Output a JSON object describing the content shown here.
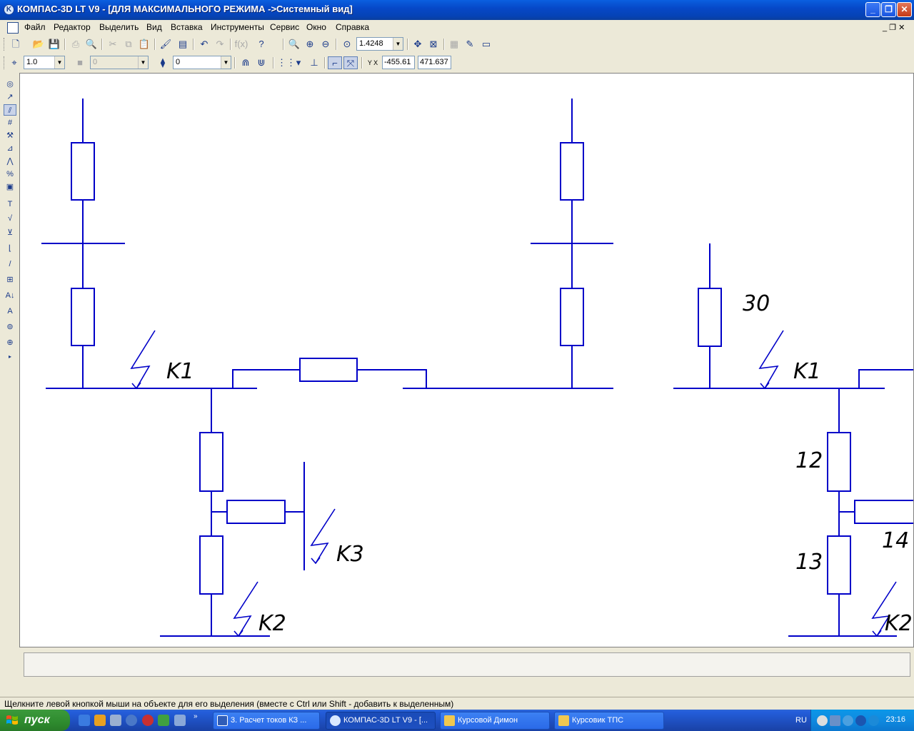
{
  "window": {
    "title": "КОМПАС-3D LT V9 - [ДЛЯ МАКСИМАЛЬНОГО РЕЖИМА ->Системный вид]",
    "minimize": "_",
    "maximize": "❐",
    "close": "✕"
  },
  "menu": {
    "items": [
      "Файл",
      "Редактор",
      "Выделить",
      "Вид",
      "Вставка",
      "Инструменты",
      "Сервис",
      "Окно",
      "Справка"
    ],
    "mdi_controls": "_ ❐ ✕"
  },
  "toolbar_main": {
    "zoom_value": "1.4248"
  },
  "toolbar_props": {
    "line_scale": "1.0",
    "layer_style": "0",
    "layer_number": "0",
    "coord_label": "Y X",
    "coord_x": "-455.61",
    "coord_y": "471.637"
  },
  "schematic_labels": {
    "k1_left": "K1",
    "k1_right": "K1",
    "k2_left": "K2",
    "k2_right": "K2",
    "k3": "K3",
    "n30": "30",
    "n12": "12",
    "n13": "13",
    "n14": "14"
  },
  "status": {
    "hint": "Щелкните левой кнопкой мыши на объекте для его выделения (вместе с Ctrl или Shift - добавить к выделенным)"
  },
  "taskbar": {
    "start_label": "пуск",
    "tasks": [
      {
        "label": "3. Расчет токов КЗ ...",
        "active": false
      },
      {
        "label": "КОМПАС-3D LT V9 - [...",
        "active": true
      },
      {
        "label": "Курсовой Димон",
        "active": false
      },
      {
        "label": "Курсовик ТПС",
        "active": false
      }
    ],
    "language": "RU",
    "clock": "23:16"
  },
  "colors": {
    "schematic_line": "#0000c8",
    "canvas_bg": "#ffffff",
    "chrome_bg": "#ece9d8",
    "titlebar": "#0648c8",
    "taskbar": "#245edb",
    "start_button": "#2e8b2e"
  }
}
